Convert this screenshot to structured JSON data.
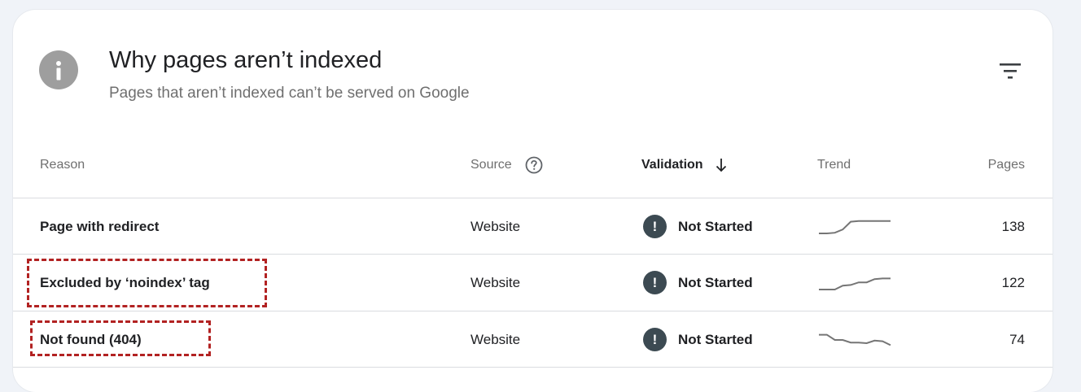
{
  "header": {
    "title": "Why pages aren’t indexed",
    "subtitle": "Pages that aren’t indexed can’t be served on Google",
    "info_icon": "info-icon",
    "filter_icon": "filter-icon"
  },
  "table": {
    "columns": {
      "reason": "Reason",
      "source": "Source",
      "validation": "Validation",
      "trend": "Trend",
      "pages": "Pages"
    },
    "sorted_by": "Validation",
    "sort_direction": "descending",
    "rows": [
      {
        "reason": "Page with redirect",
        "source": "Website",
        "validation": "Not Started",
        "pages": "138",
        "trend": [
          0,
          0,
          0.05,
          0.3,
          0.9,
          0.95,
          0.95,
          0.95,
          0.95,
          0.95
        ],
        "highlighted": false
      },
      {
        "reason": "Excluded by ‘noindex’ tag",
        "source": "Website",
        "validation": "Not Started",
        "pages": "122",
        "trend": [
          0,
          0,
          0,
          0.3,
          0.35,
          0.55,
          0.55,
          0.8,
          0.85,
          0.85
        ],
        "highlighted": true
      },
      {
        "reason": "Not found (404)",
        "source": "Website",
        "validation": "Not Started",
        "pages": "74",
        "trend": [
          0.9,
          0.9,
          0.5,
          0.5,
          0.3,
          0.3,
          0.25,
          0.45,
          0.4,
          0.1
        ],
        "highlighted": true
      }
    ]
  },
  "colors": {
    "annotation": "#b22222",
    "status_icon": "#3c4a52",
    "trend_line": "#757575"
  }
}
